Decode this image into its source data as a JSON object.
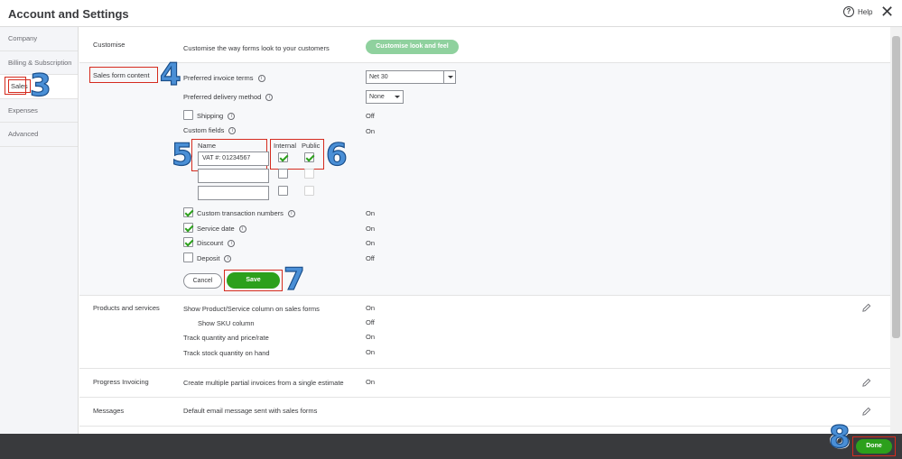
{
  "window": {
    "title": "Account and Settings",
    "help_label": "Help",
    "help_glyph": "?",
    "close_glyph": "✕"
  },
  "sidebar": {
    "items": [
      {
        "label": "Company"
      },
      {
        "label": "Billing & Subscription"
      },
      {
        "label": "Sales"
      },
      {
        "label": "Expenses"
      },
      {
        "label": "Advanced"
      }
    ]
  },
  "customise": {
    "label": "Customise",
    "description": "Customise the way forms look to your customers",
    "button_label": "Customise look and feel"
  },
  "sales_form": {
    "label": "Sales form content",
    "preferred_invoice_terms_label": "Preferred invoice terms",
    "preferred_invoice_terms_value": "Net 30",
    "preferred_delivery_label": "Preferred delivery method",
    "preferred_delivery_value": "None",
    "shipping_label": "Shipping",
    "shipping_value": "Off",
    "custom_fields_label": "Custom fields",
    "custom_fields_value": "On",
    "custom_fields_table": {
      "name_header": "Name",
      "internal_header": "Internal",
      "public_header": "Public",
      "row1_value": "VAT #: 01234567"
    },
    "custom_txn_label": "Custom transaction numbers",
    "custom_txn_value": "On",
    "service_date_label": "Service date",
    "service_date_value": "On",
    "discount_label": "Discount",
    "discount_value": "On",
    "deposit_label": "Deposit",
    "deposit_value": "Off",
    "cancel_label": "Cancel",
    "save_label": "Save"
  },
  "products": {
    "label": "Products and services",
    "show_product_label": "Show Product/Service column on sales forms",
    "show_product_value": "On",
    "show_sku_label": "Show SKU column",
    "show_sku_value": "Off",
    "track_qty_label": "Track quantity and price/rate",
    "track_qty_value": "On",
    "track_stock_label": "Track stock quantity on hand",
    "track_stock_value": "On"
  },
  "progress": {
    "label": "Progress Invoicing",
    "description": "Create multiple partial invoices from a single estimate",
    "value": "On"
  },
  "messages": {
    "label": "Messages",
    "description": "Default email message sent with sales forms"
  },
  "footer": {
    "done_label": "Done"
  },
  "annotations": {
    "step3": "3",
    "step4": "4",
    "step5": "5",
    "step6": "6",
    "step7": "7",
    "step8": "8"
  },
  "colors": {
    "accent_green": "#2ca01c",
    "annotation_red": "#d52b1e",
    "annotation_blue": "#4a8fd6"
  },
  "icons": [
    "help-icon",
    "close-icon",
    "info-icon",
    "chevron-down-icon",
    "pencil-icon"
  ]
}
